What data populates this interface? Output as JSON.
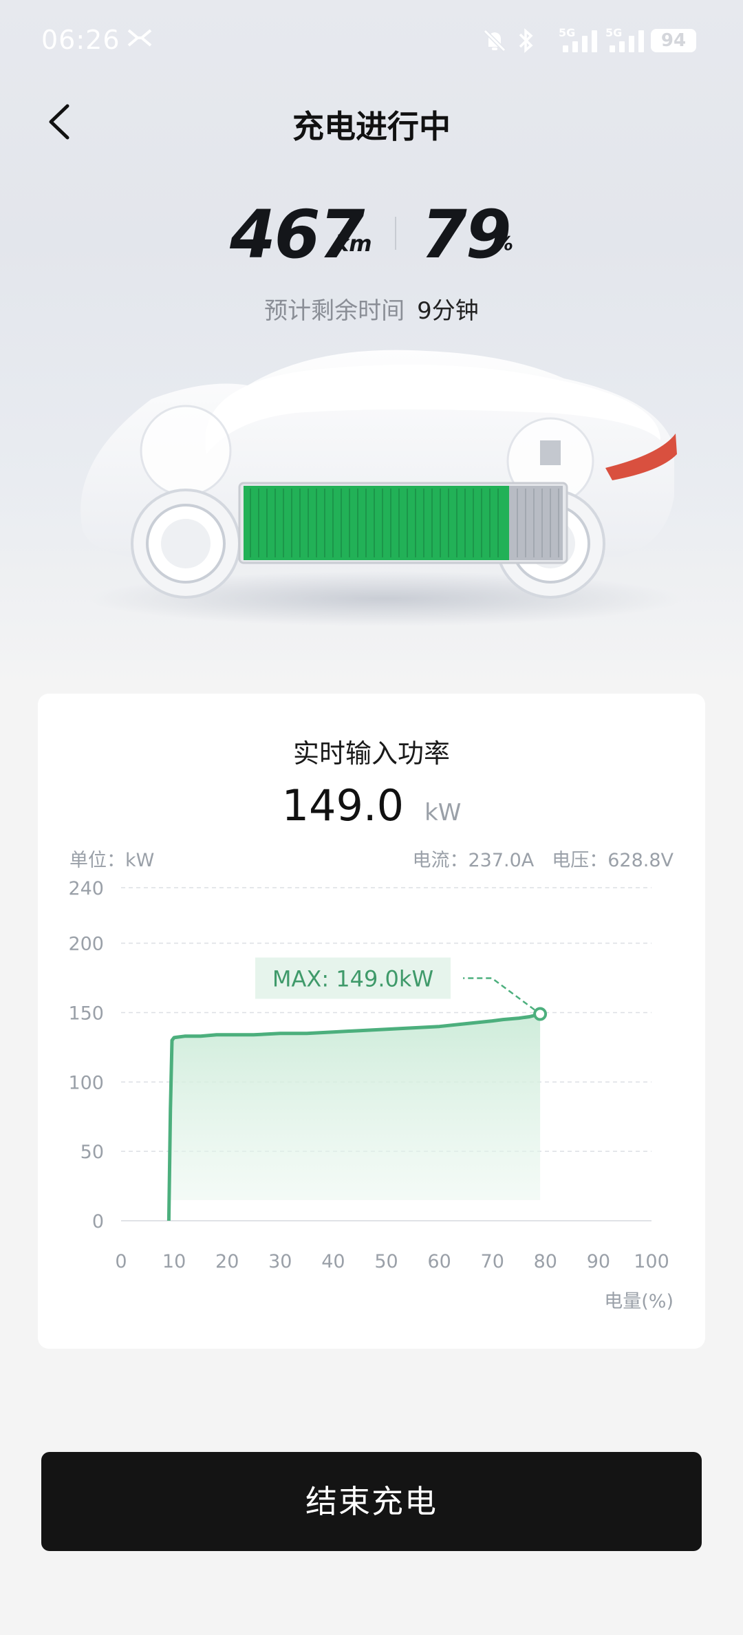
{
  "status_bar": {
    "time": "06:26",
    "net1": "5G",
    "net2": "5G",
    "battery": "94"
  },
  "header": {
    "title": "充电进行中"
  },
  "stats": {
    "range_value": "467",
    "range_unit": "km",
    "soc_value": "79",
    "soc_unit": "%",
    "eta_label": "预计剩余时间",
    "eta_value": "9分钟"
  },
  "card": {
    "title": "实时输入功率",
    "power_value": "149.0",
    "power_unit": "kW",
    "unit_label": "单位：kW",
    "current": "电流：237.0A",
    "voltage": "电压：628.8V",
    "max_label": "MAX: 149.0kW"
  },
  "chart_data": {
    "type": "area",
    "xlabel": "电量(%)",
    "ylabel": "",
    "xlim": [
      0,
      100
    ],
    "ylim": [
      0,
      240
    ],
    "x_ticks": [
      0,
      10,
      20,
      30,
      40,
      50,
      60,
      70,
      80,
      90,
      100
    ],
    "y_ticks": [
      0,
      50,
      100,
      150,
      200,
      240
    ],
    "grid": true,
    "color": "#4caf7d",
    "series": [
      {
        "x": [
          9,
          9.3,
          9.6,
          10,
          12,
          15,
          18,
          20,
          25,
          30,
          35,
          40,
          45,
          50,
          55,
          60,
          65,
          70,
          72,
          75,
          77,
          78,
          79
        ],
        "y": [
          0,
          80,
          130,
          132,
          133,
          133,
          134,
          134,
          134,
          135,
          135,
          136,
          137,
          138,
          139,
          140,
          142,
          144,
          145,
          146,
          147,
          148,
          149
        ]
      }
    ],
    "max_point": {
      "x": 79,
      "y": 149
    }
  },
  "actions": {
    "end_charge": "结束充电"
  }
}
